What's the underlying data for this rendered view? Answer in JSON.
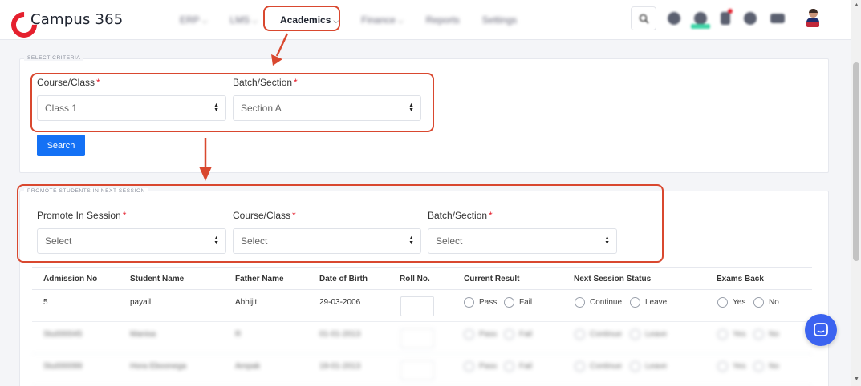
{
  "brand": {
    "name": "Campus 365",
    "color": "#e5202e"
  },
  "nav": {
    "items": [
      {
        "label": "ERP",
        "blurred": true
      },
      {
        "label": "LMS",
        "blurred": true
      },
      {
        "label": "Academics",
        "blurred": false
      },
      {
        "label": "Finance",
        "blurred": true
      },
      {
        "label": "Reports",
        "blurred": true
      },
      {
        "label": "Settings",
        "blurred": true
      }
    ],
    "chevron": "⌵"
  },
  "icons": [
    "search-icon",
    "notification-icon",
    "user-status-icon",
    "alert-icon",
    "help-icon",
    "grid-icon",
    "avatar"
  ],
  "select_criteria": {
    "legend": "SELECT CRITERIA",
    "course_label": "Course/Class",
    "course_value": "Class 1",
    "batch_label": "Batch/Section",
    "batch_value": "Section A",
    "required_mark": "*",
    "search_button": "Search"
  },
  "promote": {
    "legend": "PROMOTE STUDENTS IN NEXT SESSION",
    "session_label": "Promote In Session",
    "session_value": "Select",
    "course_label": "Course/Class",
    "course_value": "Select",
    "batch_label": "Batch/Section",
    "batch_value": "Select"
  },
  "table": {
    "columns": [
      "Admission No",
      "Student Name",
      "Father Name",
      "Date of Birth",
      "Roll No.",
      "Current Result",
      "Next Session Status",
      "Exams Back"
    ],
    "radio_labels": {
      "result": [
        "Pass",
        "Fail"
      ],
      "status": [
        "Continue",
        "Leave"
      ],
      "exams_back": [
        "Yes",
        "No"
      ]
    },
    "rows": [
      {
        "admission_no": "5",
        "student_name": "payail",
        "father_name": "Abhijit",
        "dob": "29-03-2006",
        "blurred": false
      },
      {
        "admission_no": "Stu000045",
        "student_name": "Manisa",
        "father_name": "R",
        "dob": "01-01-2013",
        "blurred": true
      },
      {
        "admission_no": "Stu000099",
        "student_name": "Hora Eboonega",
        "father_name": "Ampak",
        "dob": "19-01-2013",
        "blurred": true
      }
    ]
  },
  "colors": {
    "accent": "#1471f5",
    "highlight": "#d9482f",
    "chat": "#3b63f0"
  }
}
